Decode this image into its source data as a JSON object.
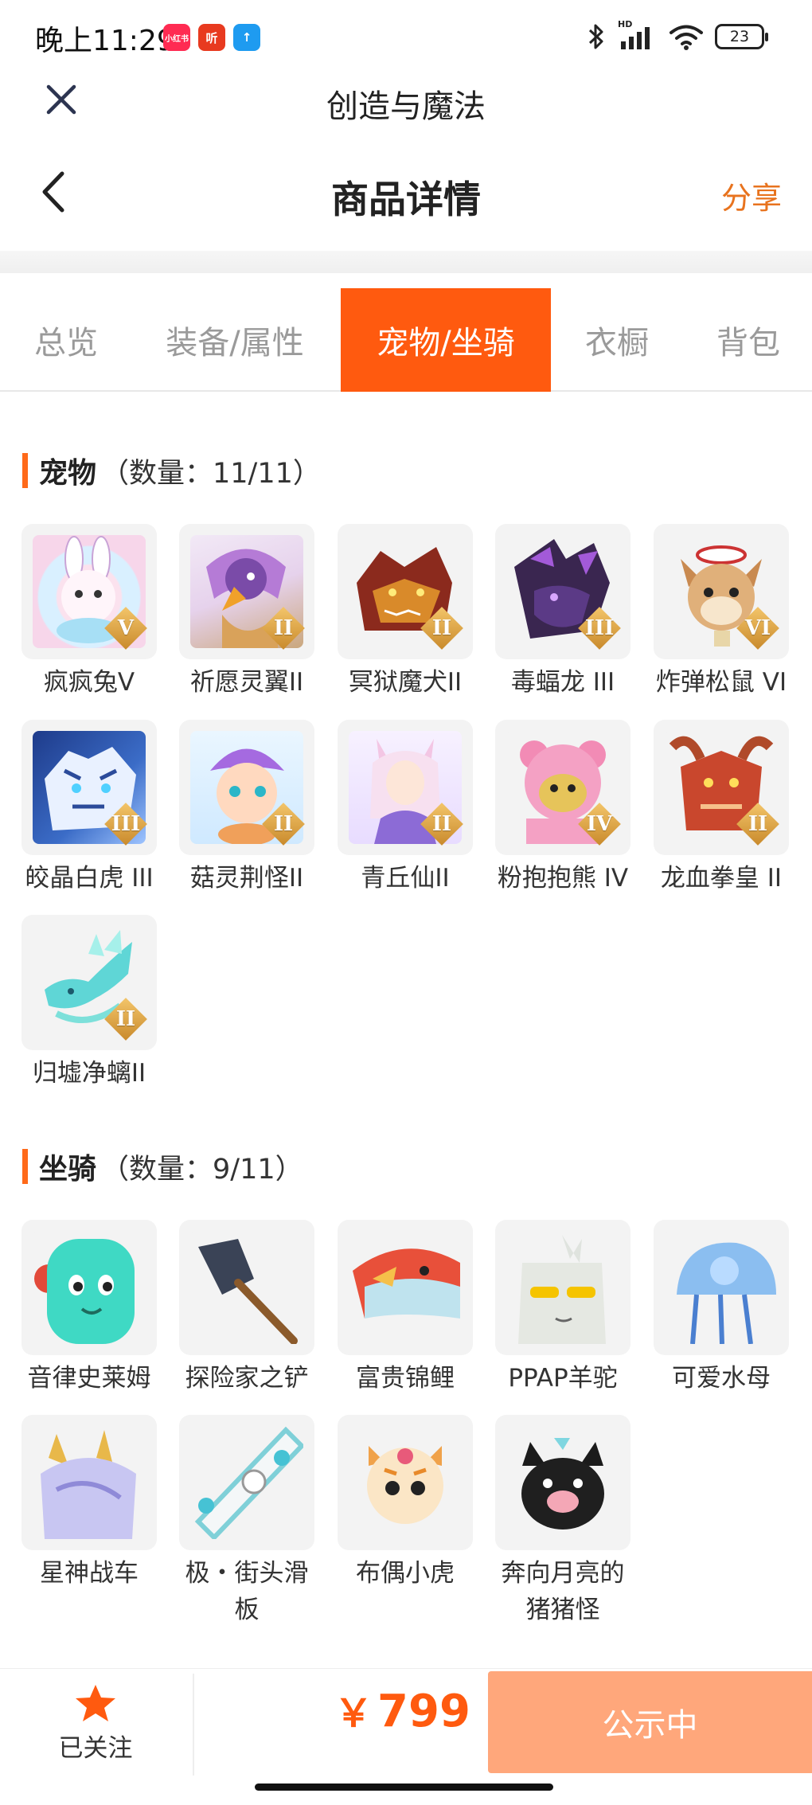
{
  "status_bar": {
    "time": "晚上11:29",
    "notifications": [
      {
        "icon": "xiaohongshu-icon",
        "text": "小红书",
        "color": "#ff2b52"
      },
      {
        "icon": "ting-icon",
        "text": "听",
        "color": "#e83a1f"
      },
      {
        "icon": "upload-icon",
        "text": "↑",
        "color": "#1e9bf0"
      }
    ],
    "network_badge": "HD",
    "battery": "23"
  },
  "mini_program": {
    "title": "创造与魔法"
  },
  "header": {
    "title": "商品详情",
    "share_label": "分享"
  },
  "tabs": [
    {
      "label": "总览",
      "active": false
    },
    {
      "label": "装备/属性",
      "active": false
    },
    {
      "label": "宠物/坐骑",
      "active": true
    },
    {
      "label": "衣橱",
      "active": false
    },
    {
      "label": "背包",
      "active": false
    }
  ],
  "pets": {
    "title": "宠物",
    "count": "（数量：11/11）",
    "items": [
      {
        "name": "疯疯兔V",
        "tier": "V",
        "icon": "rabbit-icon"
      },
      {
        "name": "祈愿灵翼II",
        "tier": "II",
        "icon": "eagle-icon"
      },
      {
        "name": "冥狱魔犬II",
        "tier": "II",
        "icon": "hellhound-icon"
      },
      {
        "name": "毒蝠龙 III",
        "tier": "III",
        "icon": "bat-dragon-icon"
      },
      {
        "name": "炸弹松鼠 VI",
        "tier": "VI",
        "icon": "squirrel-icon"
      },
      {
        "name": "皎晶白虎 III",
        "tier": "III",
        "icon": "white-tiger-icon"
      },
      {
        "name": "菇灵荆怪II",
        "tier": "II",
        "icon": "mushroom-sprite-icon"
      },
      {
        "name": "青丘仙II",
        "tier": "II",
        "icon": "fox-fairy-icon"
      },
      {
        "name": "粉抱抱熊 IV",
        "tier": "IV",
        "icon": "pink-bear-icon"
      },
      {
        "name": "龙血拳皇 II",
        "tier": "II",
        "icon": "dragon-boxer-icon"
      },
      {
        "name": "归墟净螭II",
        "tier": "II",
        "icon": "water-dragon-icon"
      }
    ]
  },
  "mounts": {
    "title": "坐骑",
    "count": "（数量：9/11）",
    "items": [
      {
        "name": "音律史莱姆",
        "icon": "slime-icon"
      },
      {
        "name": "探险家之铲",
        "icon": "shovel-icon"
      },
      {
        "name": "富贵锦鲤",
        "icon": "koi-icon"
      },
      {
        "name": "PPAP羊驼",
        "icon": "alpaca-icon"
      },
      {
        "name": "可爱水母",
        "icon": "jellyfish-icon"
      },
      {
        "name": "星神战车",
        "icon": "star-chariot-icon"
      },
      {
        "name": "极・街头滑板",
        "icon": "skateboard-icon"
      },
      {
        "name": "布偶小虎",
        "icon": "tiger-doll-icon"
      },
      {
        "name": "奔向月亮的猪猪怪",
        "icon": "pig-monster-icon"
      }
    ]
  },
  "bottom_bar": {
    "follow_label": "已关注",
    "price_symbol": "￥",
    "price": "799",
    "status_label": "公示中"
  },
  "colors": {
    "accent": "#ff5a0f",
    "share": "#e8731e",
    "status_button": "#ffa77b"
  }
}
